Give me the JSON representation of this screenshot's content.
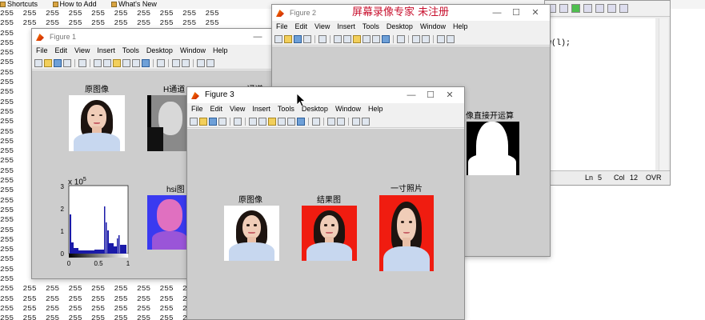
{
  "shortcuts_bar": {
    "items": [
      "Shortcuts",
      "How to Add",
      "What's New"
    ]
  },
  "matrix_background": {
    "value": "255",
    "rows_left_column": "255"
  },
  "watermark": "屏幕录像专家  未注册",
  "editor": {
    "code_fragment": "w(l);",
    "status": {
      "ln_label": "Ln",
      "ln_value": "5",
      "col_label": "Col",
      "col_value": "12",
      "mode": "OVR"
    }
  },
  "figure1": {
    "title": "Figure 1",
    "menu": [
      "File",
      "Edit",
      "View",
      "Insert",
      "Tools",
      "Desktop",
      "Window",
      "Help"
    ],
    "labels": {
      "original": "原图像",
      "h_channel": "H通道",
      "s_channel": "S通道",
      "hsi": "hsi图"
    },
    "histogram": {
      "exponent": "x 10",
      "exponent_power": "5",
      "y_ticks": [
        "3",
        "2",
        "1",
        "0"
      ],
      "x_ticks": [
        "0",
        "0.5",
        "1"
      ]
    }
  },
  "figure2": {
    "title": "Figure 2",
    "menu": [
      "File",
      "Edit",
      "View",
      "Insert",
      "Tools",
      "Desktop",
      "Window",
      "Help"
    ],
    "partial_label": "像直接开运算"
  },
  "figure3": {
    "title": "Figure 3",
    "menu": [
      "File",
      "Edit",
      "View",
      "Insert",
      "Tools",
      "Desktop",
      "Window",
      "Help"
    ],
    "labels": {
      "original": "原图像",
      "result": "结果图",
      "inch_photo": "一寸照片"
    }
  },
  "colors": {
    "red_background": "#f01c10",
    "hsi_blue": "#3a3af0",
    "hsi_pink": "#e070c0",
    "figure_gray": "#cdcdcd"
  }
}
